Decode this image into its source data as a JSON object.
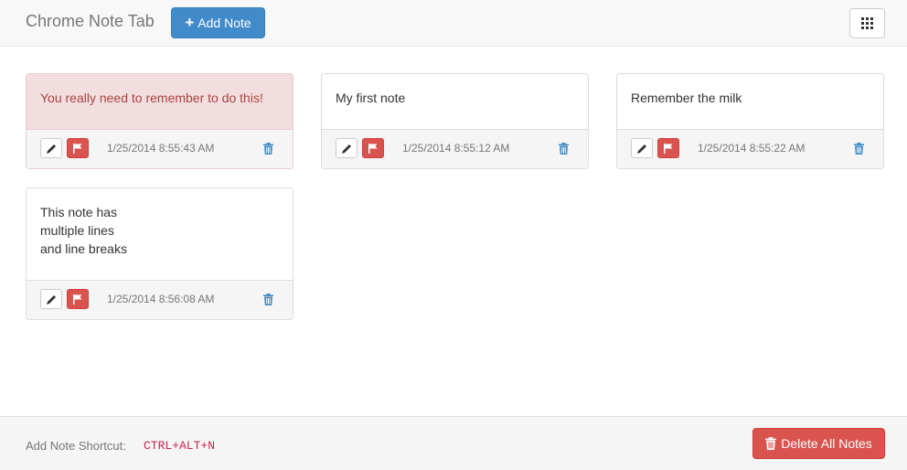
{
  "header": {
    "title": "Chrome Note Tab",
    "add_note_label": "Add Note"
  },
  "notes": [
    {
      "lines": [
        "You really need to remember to do this!"
      ],
      "timestamp": "1/25/2014 8:55:43 AM",
      "flagged": true
    },
    {
      "lines": [
        "My first note"
      ],
      "timestamp": "1/25/2014 8:55:12 AM",
      "flagged": false
    },
    {
      "lines": [
        "Remember the milk"
      ],
      "timestamp": "1/25/2014 8:55:22 AM",
      "flagged": false
    },
    {
      "lines": [
        "This note has",
        "multiple lines",
        "and line breaks"
      ],
      "timestamp": "1/25/2014 8:56:08 AM",
      "flagged": false
    }
  ],
  "footer": {
    "shortcut_label": "Add Note Shortcut:",
    "shortcut_keys": "CTRL+ALT+N",
    "delete_all_label": "Delete All Notes"
  },
  "colors": {
    "primary": "#428bca",
    "danger": "#d9534f",
    "danger_bg": "#f2dede",
    "danger_text": "#a94442"
  },
  "icons": {
    "add": "plus-icon",
    "grid": "th-icon",
    "edit": "pencil-icon",
    "flag": "flag-icon",
    "delete": "trash-icon"
  }
}
